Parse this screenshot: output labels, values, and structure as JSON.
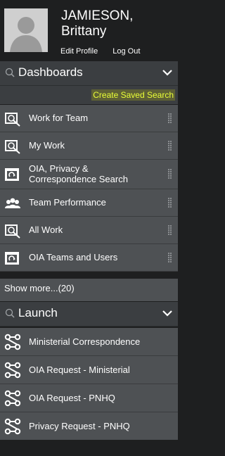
{
  "user": {
    "last_name": "JAMIESON,",
    "first_name": "Brittany",
    "edit_profile": "Edit Profile",
    "log_out": "Log Out"
  },
  "dashboards": {
    "title": "Dashboards",
    "create_saved_search": "Create Saved Search",
    "items": [
      {
        "label": "Work for Team",
        "icon": "search-document-icon"
      },
      {
        "label": "My Work",
        "icon": "search-document-icon"
      },
      {
        "label": "OIA, Privacy &",
        "label2": "Correspondence Search",
        "icon": "refresh-box-icon"
      },
      {
        "label": "Team Performance",
        "icon": "people-icon"
      },
      {
        "label": "All Work",
        "icon": "search-document-icon"
      },
      {
        "label": "OIA Teams and Users",
        "icon": "refresh-box-icon"
      }
    ],
    "show_more": "Show more...(20)"
  },
  "launch": {
    "title": "Launch",
    "items": [
      {
        "label": "Ministerial Correspondence",
        "icon": "workflow-icon"
      },
      {
        "label": "OIA Request - Ministerial",
        "icon": "workflow-icon"
      },
      {
        "label": "OIA Request - PNHQ",
        "icon": "workflow-icon"
      },
      {
        "label": "Privacy Request - PNHQ",
        "icon": "workflow-icon"
      }
    ]
  },
  "colors": {
    "panel_bg": "#1e1f20",
    "header_bg": "#3b3e41",
    "item_bg": "#4e5154",
    "highlight_link": "#eaff36"
  }
}
